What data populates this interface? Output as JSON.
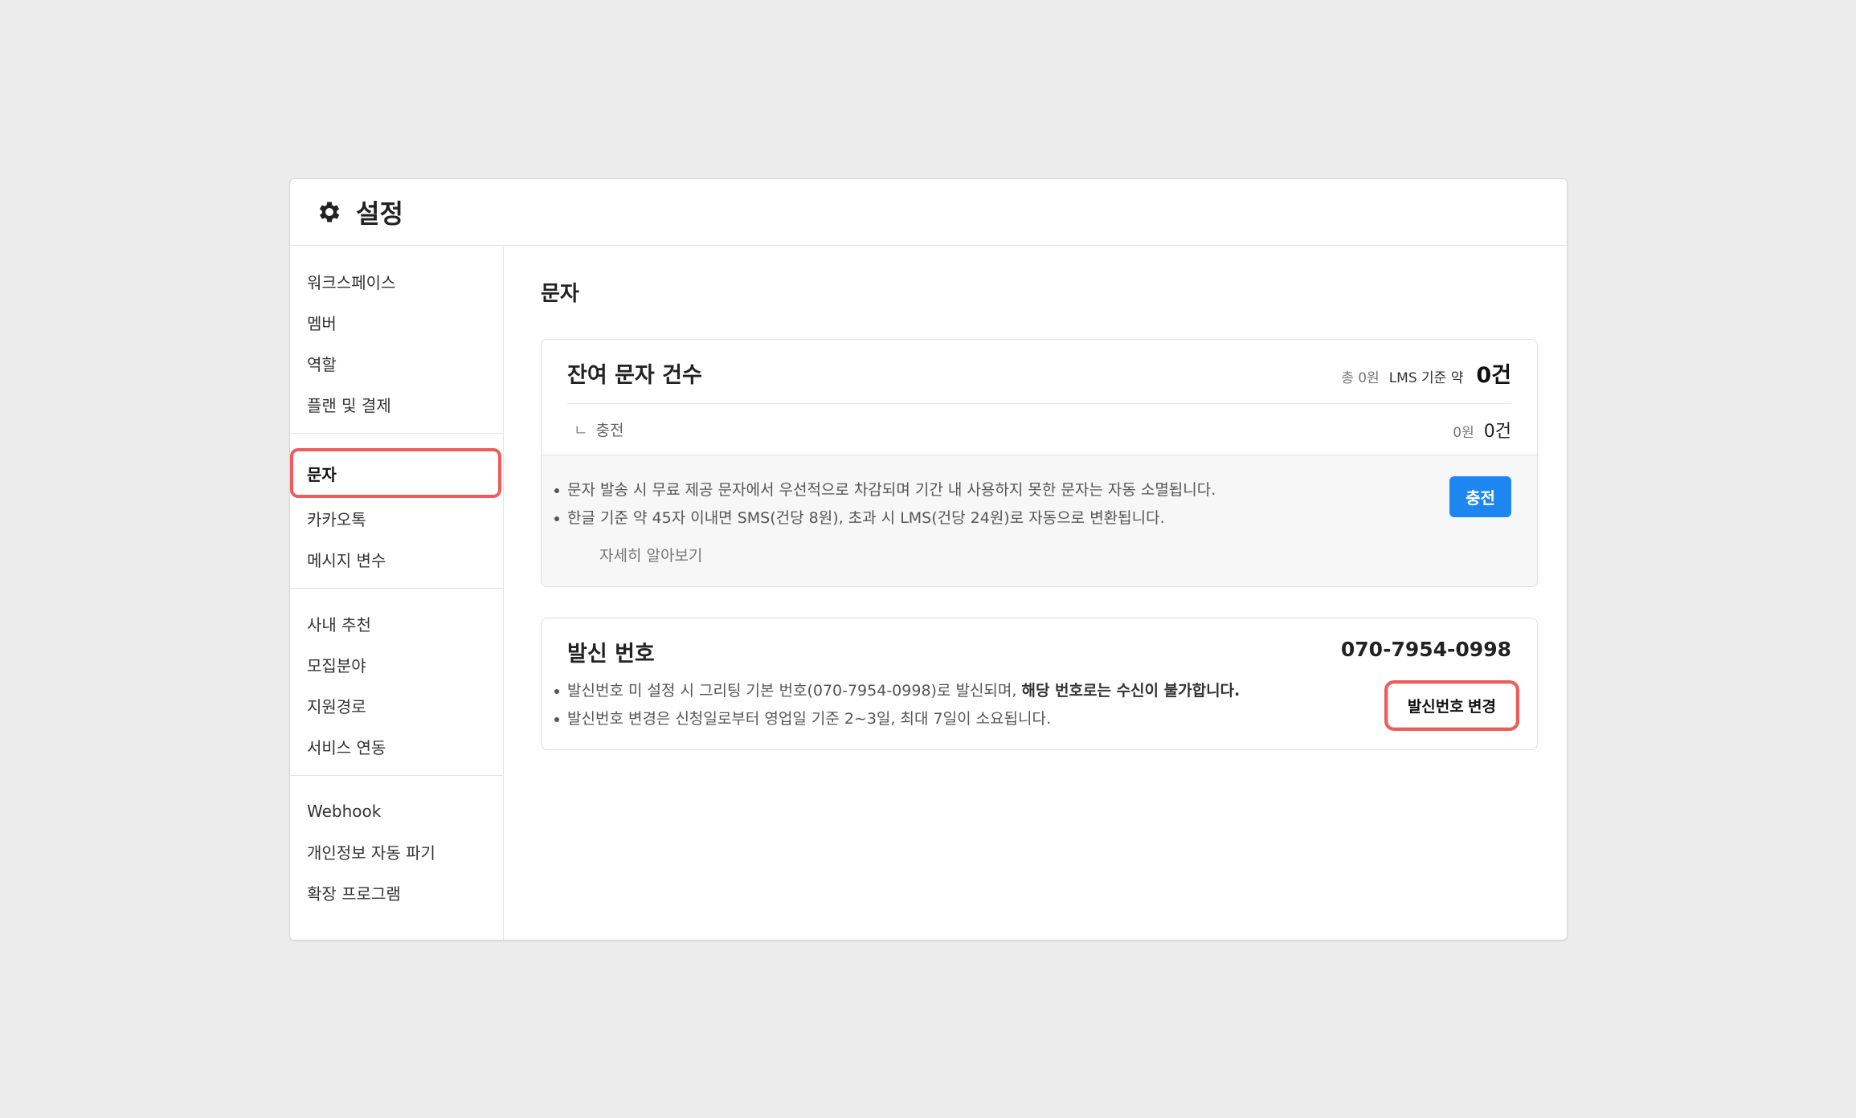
{
  "window": {
    "title": "설정",
    "icon": "gear-icon"
  },
  "sidebar": {
    "groups": [
      {
        "items": [
          {
            "label": "워크스페이스"
          },
          {
            "label": "멤버"
          },
          {
            "label": "역할"
          },
          {
            "label": "플랜 및 결제"
          }
        ]
      },
      {
        "items": [
          {
            "label": "문자",
            "active": true
          },
          {
            "label": "카카오톡"
          },
          {
            "label": "메시지 변수"
          }
        ]
      },
      {
        "items": [
          {
            "label": "사내 추천"
          },
          {
            "label": "모집분야"
          },
          {
            "label": "지원경로"
          },
          {
            "label": "서비스 연동"
          }
        ]
      },
      {
        "items": [
          {
            "label": "Webhook"
          },
          {
            "label": "개인정보 자동 파기"
          },
          {
            "label": "확장 프로그램"
          }
        ]
      }
    ]
  },
  "main": {
    "section_title": "문자",
    "remaining": {
      "title": "잔여 문자 건수",
      "total_label": "총 0원",
      "lms_label": "LMS 기준 약",
      "total_count": "0건",
      "charge_corner": "ㄴ",
      "charge_label": "충전",
      "charge_amount": "0원",
      "charge_count": "0건",
      "notes": [
        "문자 발송 시 무료 제공 문자에서 우선적으로 차감되며 기간 내 사용하지 못한 문자는 자동 소멸됩니다.",
        "한글 기준 약 45자 이내면 SMS(건당 8원), 초과 시 LMS(건당 24원)로 자동으로 변환됩니다."
      ],
      "learn_more": "자세히 알아보기",
      "charge_button": "충전"
    },
    "sender": {
      "title": "발신 번호",
      "phone": "070-7954-0998",
      "note1_prefix": "발신번호 미 설정 시 그리팅 기본 번호(070-7954-0998)로 발신되며, ",
      "note1_bold": "해당 번호로는 수신이 불가합니다.",
      "note2": "발신번호 변경은 신청일로부터 영업일 기준 2~3일, 최대 7일이 소요됩니다.",
      "change_button": "발신번호 변경"
    }
  },
  "colors": {
    "accent": "#1e86f0",
    "highlight": "#ef5c5c"
  }
}
